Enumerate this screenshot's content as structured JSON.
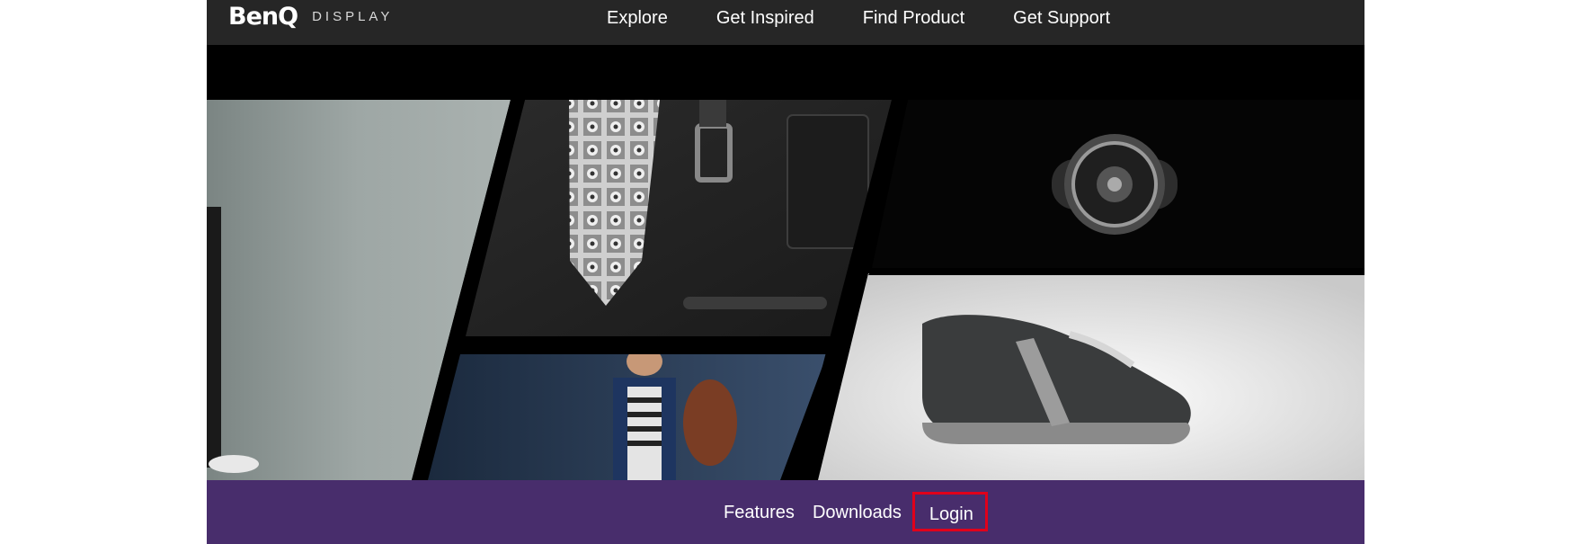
{
  "brand": {
    "logo_text": "BenQ",
    "sub_text": "DISPLAY"
  },
  "nav": {
    "items": [
      "Explore",
      "Get Inspired",
      "Find Product",
      "Get Support"
    ]
  },
  "hero": {
    "description": "Collage: tie, belt, wallet, watch, sneaker, man with bag"
  },
  "subnav": {
    "items": [
      "Features",
      "Downloads",
      "Login"
    ],
    "active_item": "Login"
  },
  "colors": {
    "topnav_bg": "#262626",
    "subnav_bg": "#482d6c",
    "highlight": "#e0001b"
  }
}
